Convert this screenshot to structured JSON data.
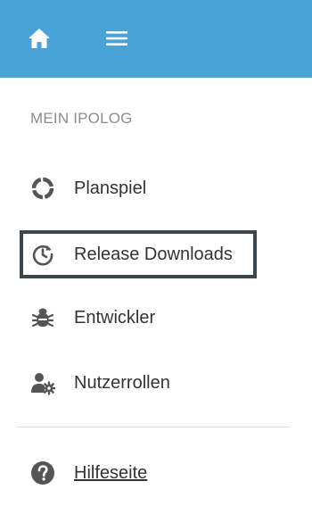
{
  "header": {
    "home_icon": "home-icon",
    "menu_icon": "hamburger-menu-icon",
    "background": "#4aa3d6"
  },
  "sidebar": {
    "section_title": "MEIN IPOLOG",
    "items": [
      {
        "label": "Planspiel",
        "icon": "circle-notch-icon"
      },
      {
        "label": "Release Downloads",
        "icon": "clock-history-icon",
        "active": true
      },
      {
        "label": "Entwickler",
        "icon": "bug-icon"
      },
      {
        "label": "Nutzerrollen",
        "icon": "user-settings-icon"
      }
    ],
    "help": {
      "label": "Hilfeseite",
      "icon": "question-circle-icon"
    }
  },
  "colors": {
    "icon": "#555555",
    "active_border": "#3b464d",
    "section_title": "#8c8c8c"
  }
}
